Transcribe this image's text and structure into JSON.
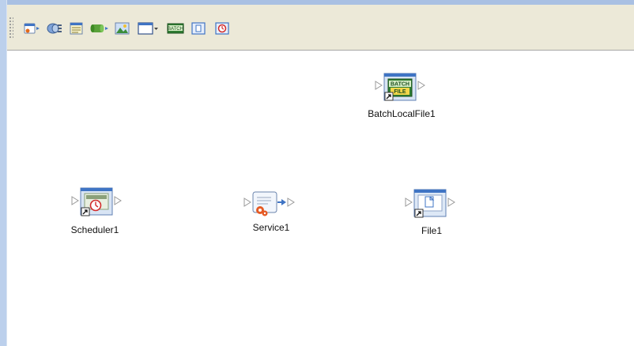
{
  "toolbar": {
    "items": [
      {
        "name": "add-file-connector-tool",
        "icon": "file-connector-icon"
      },
      {
        "name": "add-collaboration-tool",
        "icon": "collaboration-icon"
      },
      {
        "name": "add-table-tool",
        "icon": "table-icon"
      },
      {
        "name": "add-database-tool",
        "icon": "database-icon"
      },
      {
        "name": "add-image-tool",
        "icon": "image-icon"
      },
      {
        "name": "add-window-dropdown-tool",
        "icon": "window-dropdown-icon"
      },
      {
        "name": "add-batch-tool",
        "icon": "batch-icon",
        "label": "BATCH"
      },
      {
        "name": "add-file-tool",
        "icon": "file-icon"
      },
      {
        "name": "add-scheduler-tool",
        "icon": "scheduler-icon"
      }
    ]
  },
  "canvas": {
    "nodes": [
      {
        "id": "batchlocalfile1",
        "label": "BatchLocalFile1",
        "icon": "batch-file-icon",
        "badge_top": "BATCH",
        "badge_bottom": "FILE"
      },
      {
        "id": "scheduler1",
        "label": "Scheduler1",
        "icon": "scheduler-icon"
      },
      {
        "id": "service1",
        "label": "Service1",
        "icon": "service-icon"
      },
      {
        "id": "file1",
        "label": "File1",
        "icon": "file-icon"
      }
    ]
  },
  "colors": {
    "frame": "#a9c0e3",
    "toolbar": "#ece9d8",
    "arrow": "#9a9a9a"
  }
}
